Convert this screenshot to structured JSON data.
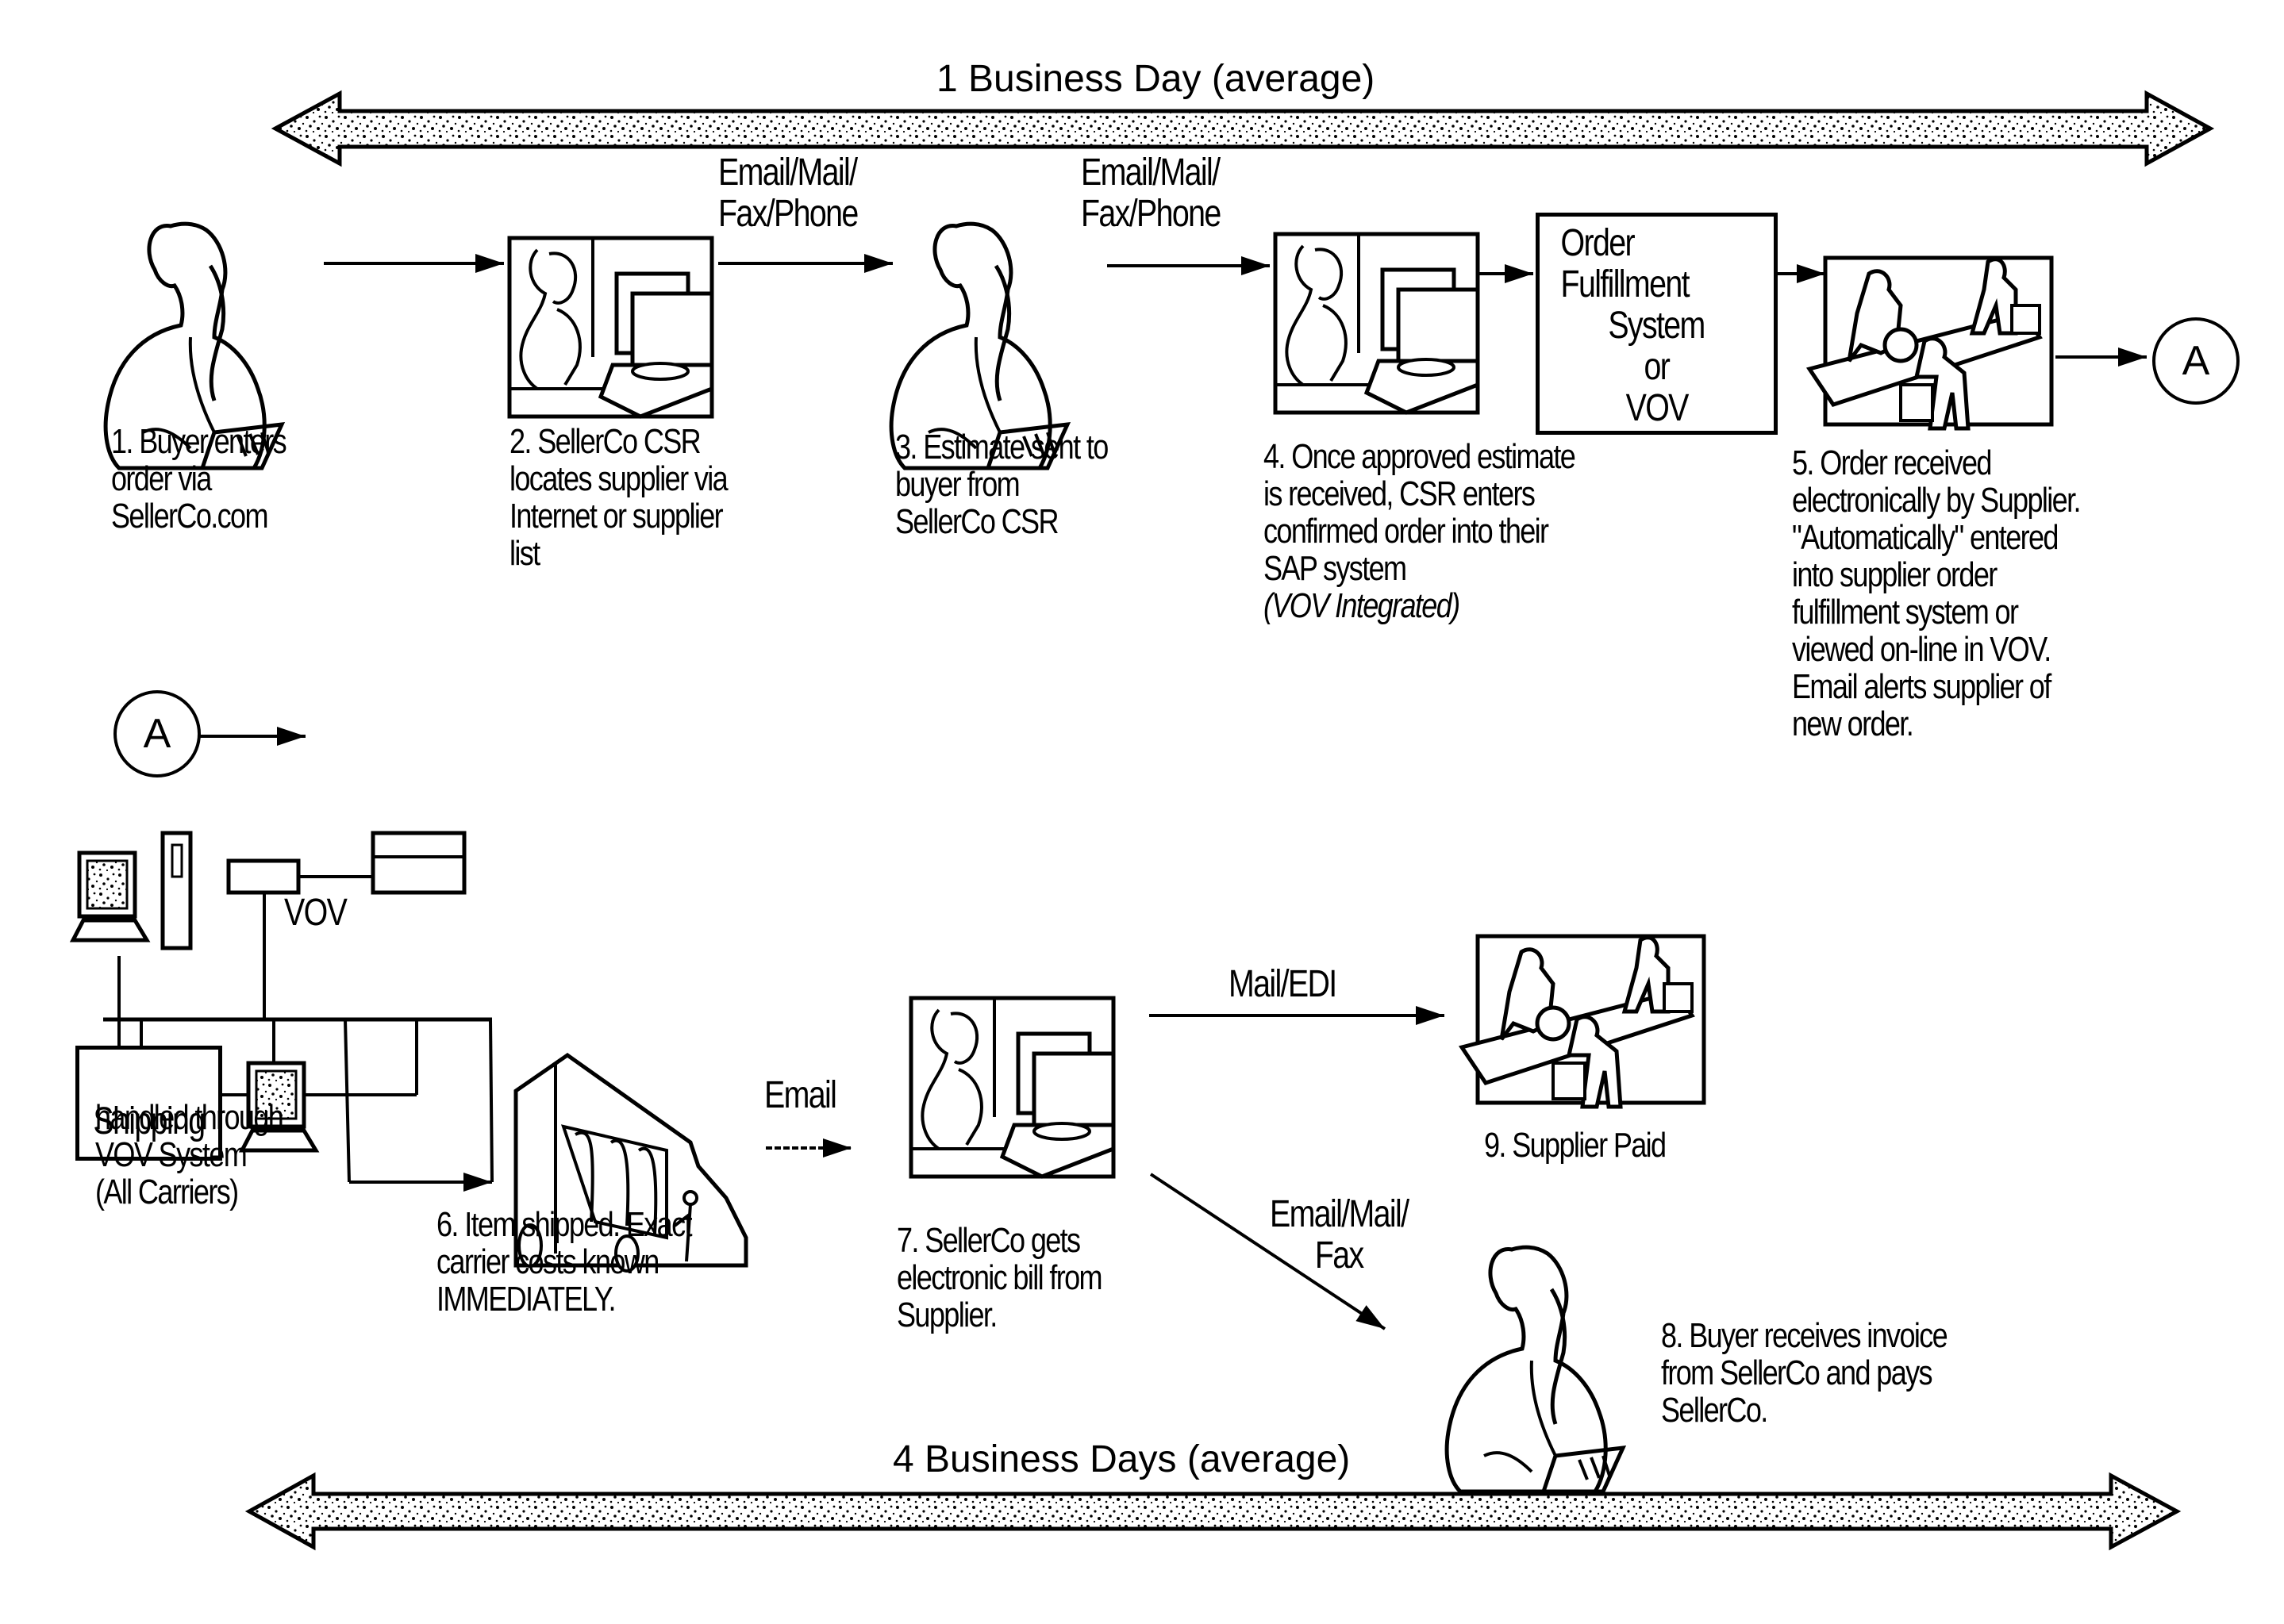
{
  "timeline": {
    "top_label": "1 Business Day (average)",
    "bottom_label": "4 Business Days (average)"
  },
  "connector": {
    "label": "A"
  },
  "edges": {
    "buyer_to_csr": "",
    "csr_to_estimate": "Email/Mail/\nFax/Phone",
    "estimate_to_csr": "Email/Mail/\nFax/Phone",
    "shipped_to_bill": "Email",
    "bill_to_supplier_paid": "Mail/EDI",
    "bill_to_buyer_invoice": "Email/Mail/\nFax"
  },
  "order_system_box": {
    "lines": [
      "Order Fulfillment",
      "System",
      "or",
      "VOV"
    ]
  },
  "network": {
    "vov_label": "VOV",
    "shipping_label": "Shipping",
    "caption": "handled through\nVOV System\n(All Carriers)"
  },
  "steps": [
    {
      "id": 1,
      "icon": "buyer-on-phone-icon",
      "caption": "1. Buyer enters\norder via\nSellerCo.com"
    },
    {
      "id": 2,
      "icon": "csr-at-computer-icon",
      "caption": "2. SellerCo CSR\nlocates supplier via\nInternet or supplier\nlist"
    },
    {
      "id": 3,
      "icon": "buyer-on-phone-icon",
      "caption": "3. Estimate sent to\nbuyer from\nSellerCo CSR"
    },
    {
      "id": 4,
      "icon": "csr-at-computer-icon",
      "caption": "4. Once approved estimate\nis received, CSR enters\nconfirmed order into their\nSAP system",
      "note": "(VOV Integrated)"
    },
    {
      "id": 5,
      "icon": "warehouse-workers-icon",
      "caption": "5. Order received\nelectronically by Supplier.\n\"Automatically\" entered\ninto supplier order\nfulfillment system or\nviewed on-line in VOV.\nEmail alerts supplier of\nnew order."
    },
    {
      "id": 6,
      "icon": "delivery-truck-icon",
      "caption": "6. Item shipped. Exact\ncarrier costs known\nIMMEDIATELY."
    },
    {
      "id": 7,
      "icon": "csr-at-computer-icon",
      "caption": "7. SellerCo gets\nelectronic bill from\nSupplier."
    },
    {
      "id": 8,
      "icon": "buyer-on-phone-icon",
      "caption": "8. Buyer receives invoice\nfrom SellerCo and pays\nSellerCo."
    },
    {
      "id": 9,
      "icon": "warehouse-workers-icon",
      "caption": "9. Supplier Paid"
    }
  ]
}
